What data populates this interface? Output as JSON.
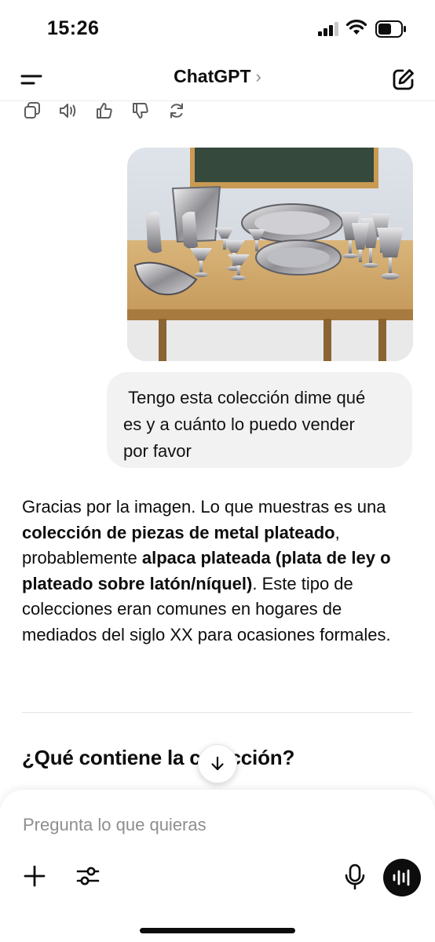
{
  "status": {
    "time": "15:26"
  },
  "header": {
    "title": "ChatGPT",
    "chevron": "›"
  },
  "message_actions": [
    "copy-icon",
    "speaker-icon",
    "thumbs-up-icon",
    "thumbs-down-icon",
    "regenerate-icon"
  ],
  "user": {
    "image_alt": "",
    "text": " Tengo esta colección dime qué\nes y a cuánto lo puedo vender\npor favor"
  },
  "answer": {
    "p1": "Gracias por la imagen. Lo que muestras es una ",
    "b1": "colección de piezas de metal plateado",
    "p2": ", probablemente ",
    "b2": "alpaca plateada (plata de ley o plateado sobre latón/níquel)",
    "p3": ". Este tipo de colecciones eran comunes en hogares de mediados del siglo XX para ocasiones formales."
  },
  "section": {
    "heading": "¿Qué contiene la colección?"
  },
  "composer": {
    "placeholder": "Pregunta lo que quieras"
  },
  "colors": {
    "text": "#0d0d0d",
    "bubble": "#f2f2f2",
    "muted": "#8e8e8e"
  }
}
